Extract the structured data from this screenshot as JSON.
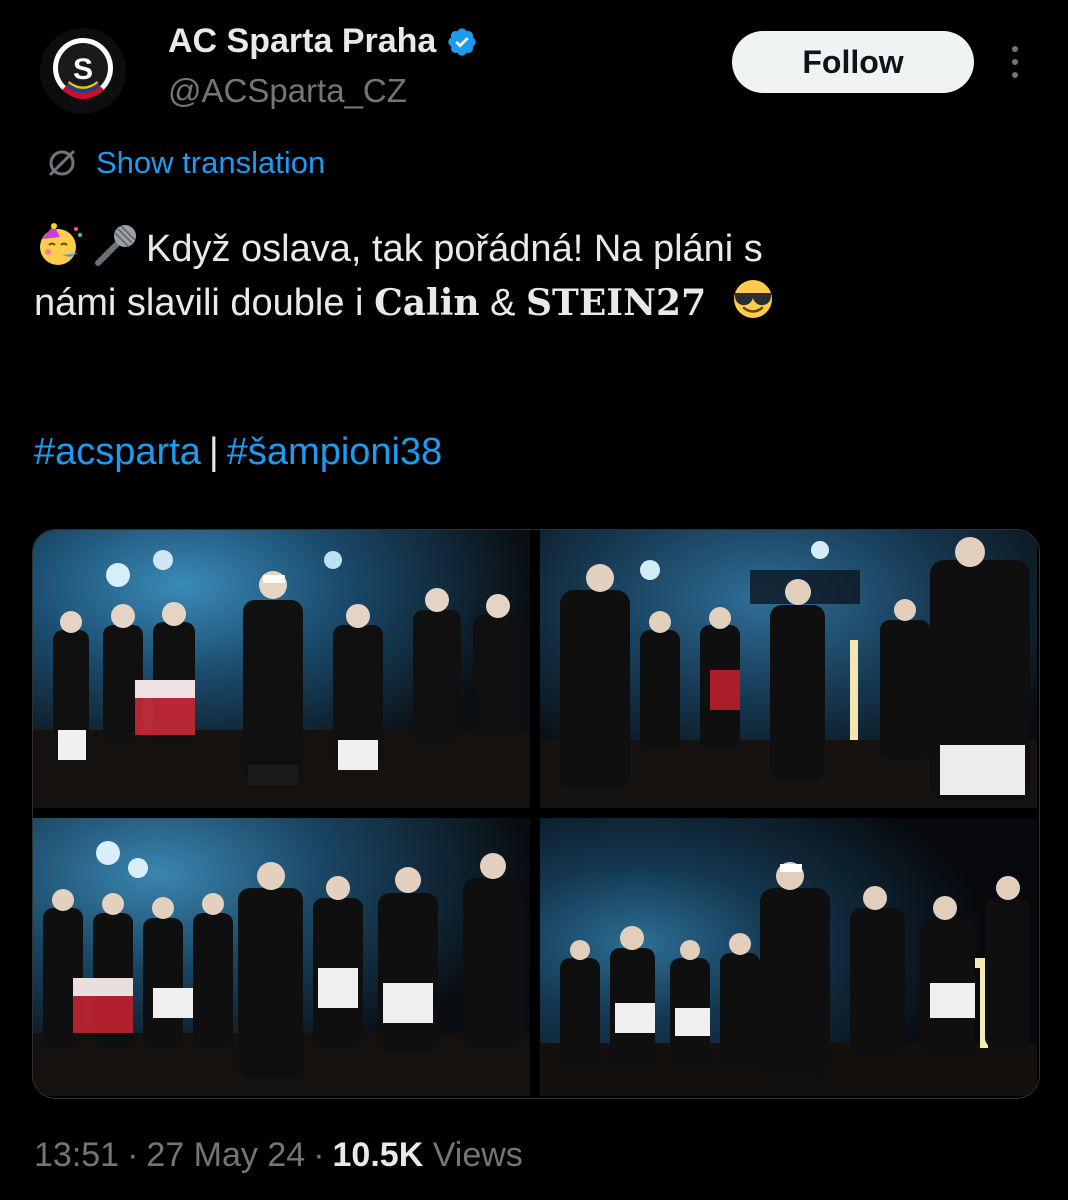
{
  "account": {
    "display_name": "AC Sparta Praha",
    "handle": "@ACSparta_CZ",
    "logo_letter": "S"
  },
  "follow_label": "Follow",
  "translation_label": "Show translation",
  "tweet": {
    "line1_text": "Když oslava, tak pořádná! Na pláni s",
    "line2_prefix": "námi slavili double i ",
    "line2_name1": "Calin",
    "line2_amp": " & ",
    "line2_name2": "STEIN27",
    "emojis": [
      "partying-face",
      "microphone",
      "smiling-face-with-sunglasses"
    ]
  },
  "hashtags": {
    "first": "#acsparta",
    "separator": "|",
    "second": "#šampioni38"
  },
  "media": {
    "photos": [
      {
        "name": "celebration-photo-1"
      },
      {
        "name": "celebration-photo-2"
      },
      {
        "name": "celebration-photo-3"
      },
      {
        "name": "celebration-photo-4"
      }
    ]
  },
  "meta": {
    "time": "13:51",
    "date": "27 May 24",
    "views_count": "10.5K",
    "views_label": "Views",
    "separator": "·"
  },
  "colors": {
    "background": "#000000",
    "text": "#e7e9ea",
    "secondary_text": "#71767b",
    "link": "#1d9bf0",
    "verified": "#1d9bf0",
    "follow_bg": "#eff3f4"
  }
}
